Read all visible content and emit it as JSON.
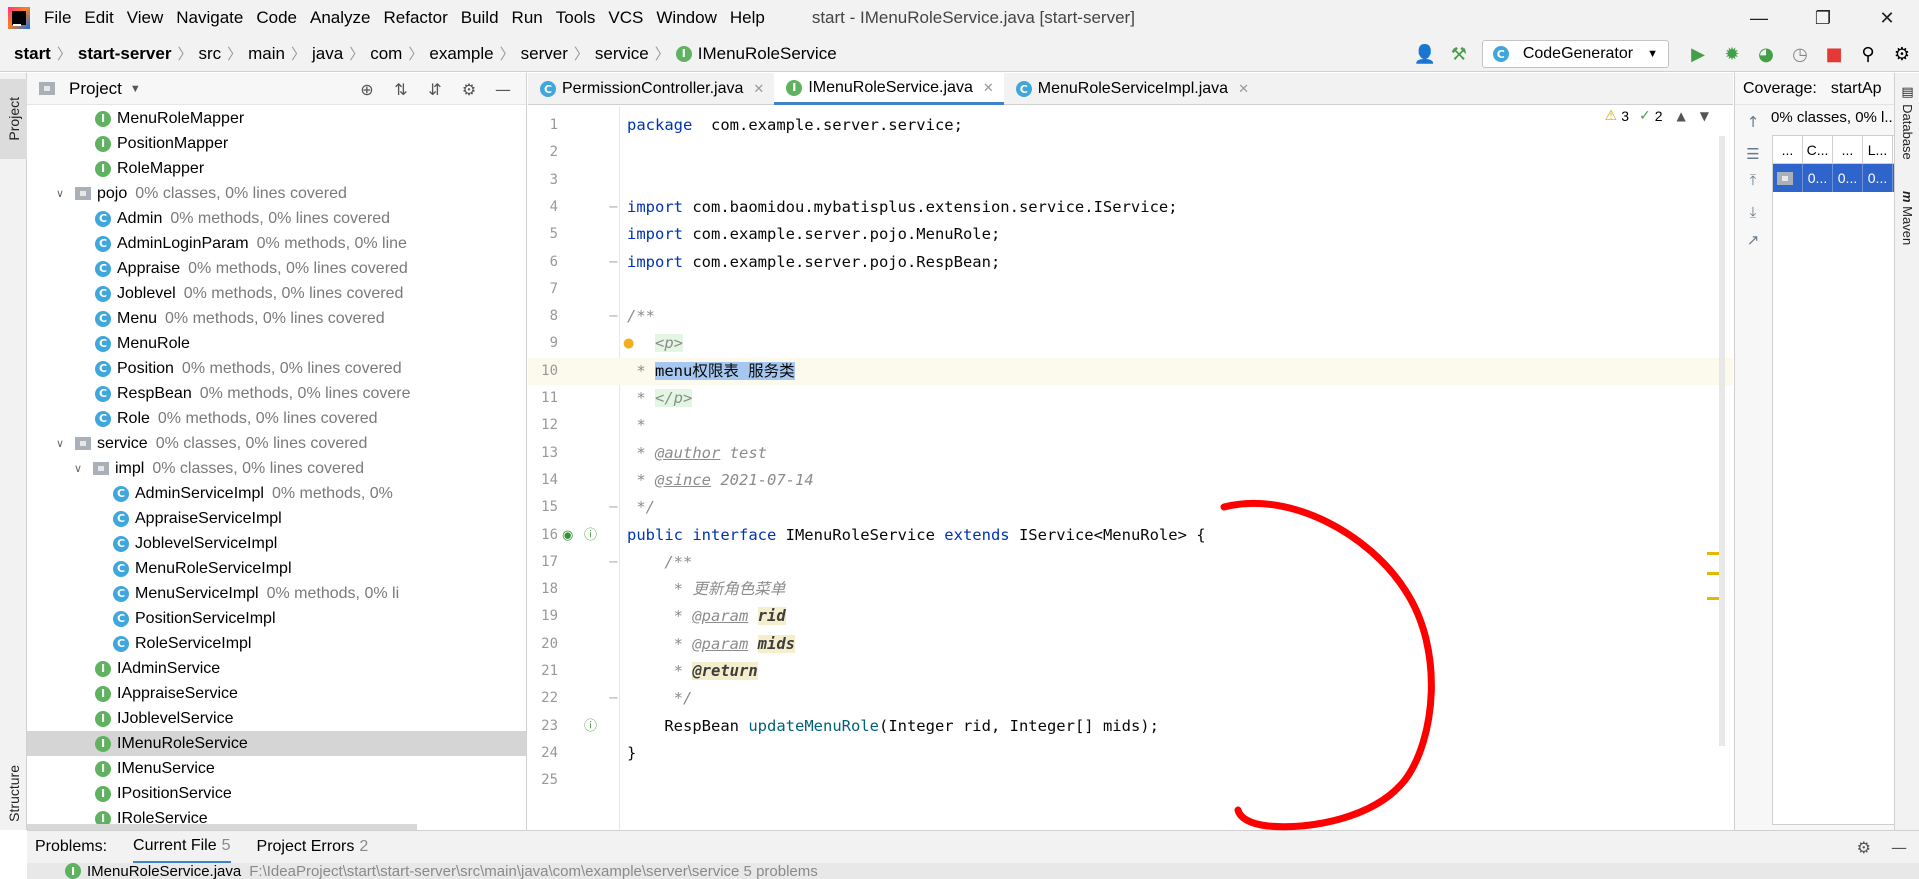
{
  "menu": {
    "items": [
      "File",
      "Edit",
      "View",
      "Navigate",
      "Code",
      "Analyze",
      "Refactor",
      "Build",
      "Run",
      "Tools",
      "VCS",
      "Window",
      "Help"
    ],
    "window_title": "start - IMenuRoleService.java [start-server]"
  },
  "breadcrumb": [
    "start",
    "start-server",
    "src",
    "main",
    "java",
    "com",
    "example",
    "server",
    "service",
    "IMenuRoleService"
  ],
  "toolbar": {
    "run_config": "CodeGenerator"
  },
  "left_stripe": {
    "project": "Project",
    "structure": "Structure"
  },
  "project_panel": {
    "title": "Project",
    "tree": [
      {
        "name": "MenuRoleMapper",
        "icon": "interface-icon",
        "indent": 3,
        "coverage": ""
      },
      {
        "name": "PositionMapper",
        "icon": "interface-icon",
        "indent": 3,
        "coverage": ""
      },
      {
        "name": "RoleMapper",
        "icon": "interface-icon",
        "indent": 3,
        "coverage": ""
      },
      {
        "name": "pojo",
        "icon": "package-icon",
        "indent": 2,
        "expanded": true,
        "coverage": "0% classes, 0% lines covered"
      },
      {
        "name": "Admin",
        "icon": "class-icon",
        "indent": 3,
        "coverage": "0% methods, 0% lines covered"
      },
      {
        "name": "AdminLoginParam",
        "icon": "class-icon",
        "indent": 3,
        "coverage": "0% methods, 0% line"
      },
      {
        "name": "Appraise",
        "icon": "class-icon",
        "indent": 3,
        "coverage": "0% methods, 0% lines covered"
      },
      {
        "name": "Joblevel",
        "icon": "class-icon",
        "indent": 3,
        "coverage": "0% methods, 0% lines covered"
      },
      {
        "name": "Menu",
        "icon": "class-icon",
        "indent": 3,
        "coverage": "0% methods, 0% lines covered"
      },
      {
        "name": "MenuRole",
        "icon": "class-icon",
        "indent": 3,
        "coverage": ""
      },
      {
        "name": "Position",
        "icon": "class-icon",
        "indent": 3,
        "coverage": "0% methods, 0% lines covered"
      },
      {
        "name": "RespBean",
        "icon": "class-icon",
        "indent": 3,
        "coverage": "0% methods, 0% lines covere"
      },
      {
        "name": "Role",
        "icon": "class-icon",
        "indent": 3,
        "coverage": "0% methods, 0% lines covered"
      },
      {
        "name": "service",
        "icon": "package-icon",
        "indent": 2,
        "expanded": true,
        "coverage": "0% classes, 0% lines covered"
      },
      {
        "name": "impl",
        "icon": "package-icon",
        "indent": 3,
        "expanded": true,
        "coverage": "0% classes, 0% lines covered"
      },
      {
        "name": "AdminServiceImpl",
        "icon": "class-icon",
        "indent": 4,
        "coverage": "0% methods, 0%"
      },
      {
        "name": "AppraiseServiceImpl",
        "icon": "class-icon",
        "indent": 4,
        "coverage": ""
      },
      {
        "name": "JoblevelServiceImpl",
        "icon": "class-icon",
        "indent": 4,
        "coverage": ""
      },
      {
        "name": "MenuRoleServiceImpl",
        "icon": "class-icon",
        "indent": 4,
        "coverage": ""
      },
      {
        "name": "MenuServiceImpl",
        "icon": "class-icon",
        "indent": 4,
        "coverage": "0% methods, 0% li"
      },
      {
        "name": "PositionServiceImpl",
        "icon": "class-icon",
        "indent": 4,
        "coverage": ""
      },
      {
        "name": "RoleServiceImpl",
        "icon": "class-icon",
        "indent": 4,
        "coverage": ""
      },
      {
        "name": "IAdminService",
        "icon": "interface-icon",
        "indent": 3,
        "coverage": ""
      },
      {
        "name": "IAppraiseService",
        "icon": "interface-icon",
        "indent": 3,
        "coverage": ""
      },
      {
        "name": "IJoblevelService",
        "icon": "interface-icon",
        "indent": 3,
        "coverage": ""
      },
      {
        "name": "IMenuRoleService",
        "icon": "interface-icon",
        "indent": 3,
        "coverage": "",
        "selected": true
      },
      {
        "name": "IMenuService",
        "icon": "interface-icon",
        "indent": 3,
        "coverage": ""
      },
      {
        "name": "IPositionService",
        "icon": "interface-icon",
        "indent": 3,
        "coverage": ""
      },
      {
        "name": "IRoleService",
        "icon": "interface-icon",
        "indent": 3,
        "coverage": ""
      }
    ]
  },
  "editor": {
    "tabs": [
      {
        "label": "PermissionController.java",
        "icon": "class-icon",
        "active": false
      },
      {
        "label": "IMenuRoleService.java",
        "icon": "interface-icon",
        "active": true
      },
      {
        "label": "MenuRoleServiceImpl.java",
        "icon": "class-icon",
        "active": false
      }
    ],
    "inspection": {
      "warnings": "3",
      "typos": "2"
    },
    "lines": [
      {
        "n": "1",
        "parts": [
          [
            "kw",
            "package"
          ],
          [
            "",
            "  com.example.server.service;"
          ]
        ]
      },
      {
        "n": "2",
        "parts": []
      },
      {
        "n": "3",
        "parts": []
      },
      {
        "n": "4",
        "parts": [
          [
            "kw",
            "import"
          ],
          [
            "",
            " com.baomidou.mybatisplus.extension.service.IService;"
          ]
        ]
      },
      {
        "n": "5",
        "parts": [
          [
            "kw",
            "import"
          ],
          [
            "",
            " com.example.server.pojo.MenuRole;"
          ]
        ]
      },
      {
        "n": "6",
        "parts": [
          [
            "kw",
            "import"
          ],
          [
            "",
            " com.example.server.pojo.RespBean;"
          ]
        ]
      },
      {
        "n": "7",
        "parts": []
      },
      {
        "n": "8",
        "parts": [
          [
            "cm",
            "/**"
          ]
        ]
      },
      {
        "n": "9",
        "parts": [
          [
            "cm",
            "   "
          ],
          [
            "tag",
            "<p>"
          ]
        ]
      },
      {
        "n": "10",
        "parts": [
          [
            "cm",
            " * "
          ],
          [
            "sel",
            "menu权限表 服务类"
          ]
        ],
        "current": true
      },
      {
        "n": "11",
        "parts": [
          [
            "cm",
            " * "
          ],
          [
            "tag",
            "</p>"
          ]
        ]
      },
      {
        "n": "12",
        "parts": [
          [
            "cm",
            " *"
          ]
        ]
      },
      {
        "n": "13",
        "parts": [
          [
            "cm",
            " * "
          ],
          [
            "doctag",
            "@author"
          ],
          [
            "cm",
            " test"
          ]
        ]
      },
      {
        "n": "14",
        "parts": [
          [
            "cm",
            " * "
          ],
          [
            "doctag",
            "@since"
          ],
          [
            "cm",
            " 2021-07-14"
          ]
        ]
      },
      {
        "n": "15",
        "parts": [
          [
            "cm",
            " */"
          ]
        ]
      },
      {
        "n": "16",
        "parts": [
          [
            "kw",
            "public interface"
          ],
          [
            "",
            " IMenuRoleService "
          ],
          [
            "kw",
            "extends"
          ],
          [
            "",
            " IService<MenuRole> {"
          ]
        ]
      },
      {
        "n": "17",
        "parts": [
          [
            "cm",
            "    /**"
          ]
        ]
      },
      {
        "n": "18",
        "parts": [
          [
            "cm",
            "     * 更新角色菜单"
          ]
        ]
      },
      {
        "n": "19",
        "parts": [
          [
            "cm",
            "     * "
          ],
          [
            "doctag",
            "@param"
          ],
          [
            "cm",
            " "
          ],
          [
            "docparam",
            "rid"
          ]
        ]
      },
      {
        "n": "20",
        "parts": [
          [
            "cm",
            "     * "
          ],
          [
            "doctag",
            "@param"
          ],
          [
            "cm",
            " "
          ],
          [
            "docparam",
            "mids"
          ]
        ]
      },
      {
        "n": "21",
        "parts": [
          [
            "cm",
            "     * "
          ],
          [
            "docparam",
            "@return"
          ]
        ]
      },
      {
        "n": "22",
        "parts": [
          [
            "cm",
            "     */"
          ]
        ]
      },
      {
        "n": "23",
        "parts": [
          [
            "",
            "    RespBean "
          ],
          [
            "fn",
            "updateMenuRole"
          ],
          [
            "",
            "(Integer rid, Integer[] mids);"
          ]
        ]
      },
      {
        "n": "24",
        "parts": [
          [
            "",
            "}"
          ]
        ]
      },
      {
        "n": "25",
        "parts": []
      }
    ]
  },
  "coverage": {
    "title": "Coverage:",
    "tab": "startAp",
    "summary": "0% classes, 0% l...",
    "headers": [
      "...",
      "C...",
      "...",
      "L..."
    ],
    "row": [
      "",
      "0...",
      "0...",
      "0..."
    ]
  },
  "right_stripe": {
    "database": "Database",
    "maven": "Maven"
  },
  "problems": {
    "label": "Problems:",
    "tabs": [
      {
        "label": "Current File",
        "count": "5",
        "active": true
      },
      {
        "label": "Project Errors",
        "count": "2",
        "active": false
      }
    ],
    "file": "IMenuRoleService.java",
    "file_path": "F:\\IdeaProject\\start\\start-server\\src\\main\\java\\com\\example\\server\\service  5 problems"
  },
  "colors": {
    "accent": "#4083c9",
    "annotation": "#ff0000",
    "interface_icon": "#5fb25f",
    "class_icon": "#3fa7dc"
  }
}
